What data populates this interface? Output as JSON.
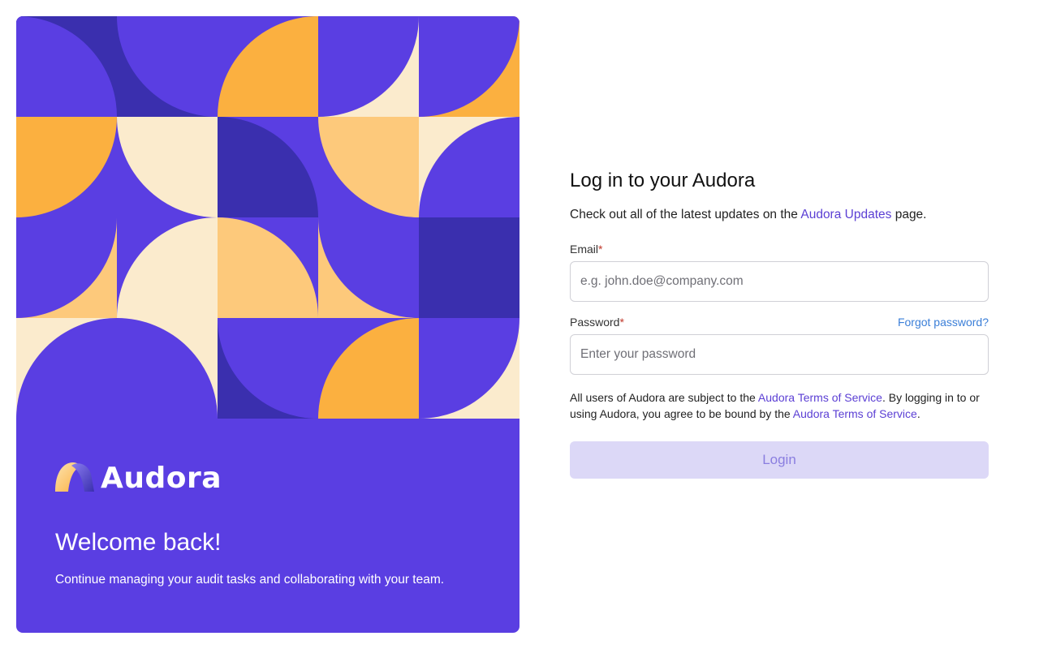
{
  "hero": {
    "brand_name": "Audora",
    "welcome_title": "Welcome back!",
    "welcome_subtitle": "Continue managing your audit tasks and collaborating with your team.",
    "colors": {
      "background": "#5a3ee2",
      "dark_purple": "#3a2fae",
      "orange": "#fbb040",
      "peach": "#fdc97b",
      "cream": "#fbebcd"
    }
  },
  "form": {
    "title": "Log in to your Audora",
    "updates_prefix": "Check out all of the latest updates on the ",
    "updates_link": "Audora Updates",
    "updates_suffix": " page.",
    "email": {
      "label": "Email",
      "required_mark": "*",
      "placeholder": "e.g. john.doe@company.com",
      "value": ""
    },
    "password": {
      "label": "Password",
      "required_mark": "*",
      "forgot_link": "Forgot password?",
      "placeholder": "Enter your password",
      "value": ""
    },
    "terms": {
      "part1": "All users of Audora are subject to the ",
      "link1": "Audora Terms of Service",
      "part2": ". By logging in to or using Audora, you agree to be bound by the ",
      "link2": "Audora Terms of Service",
      "part3": "."
    },
    "login_button": "Login",
    "colors": {
      "link": "#5b3fd4",
      "forgot_link": "#3b7fd8",
      "button_bg": "#dcd8f7",
      "button_text": "#8a7ee0"
    }
  }
}
